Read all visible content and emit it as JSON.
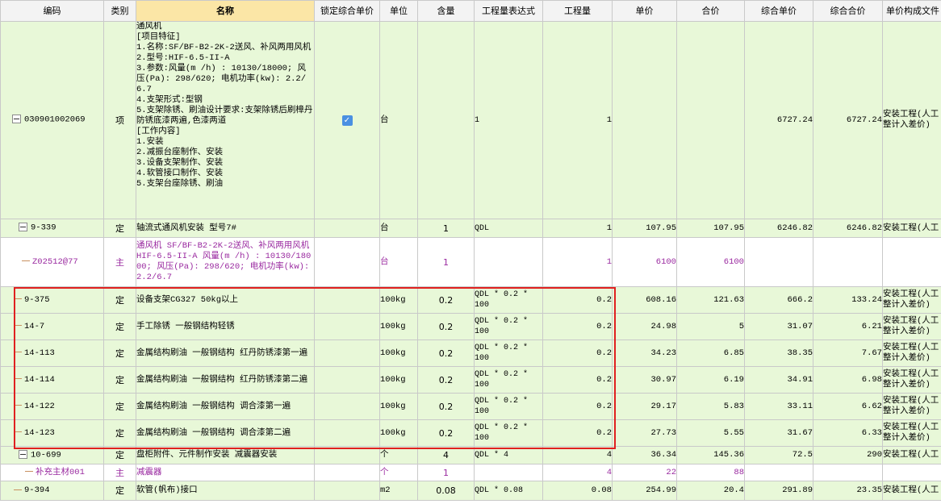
{
  "header": {
    "code": "编码",
    "type": "类别",
    "name": "名称",
    "lock": "锁定综合单价",
    "unit": "单位",
    "content": "含量",
    "expr": "工程量表达式",
    "qty": "工程量",
    "price": "单价",
    "total": "合价",
    "comp_price": "综合单价",
    "comp_total": "综合合价",
    "compose": "单价构成文件"
  },
  "item": {
    "code": "030901002069",
    "type": "项",
    "name_lines": [
      "通风机",
      "[项目特征]",
      "1.名称:SF/BF-B2-2K-2送风、补风两用风机",
      "2.型号:HIF-6.5-II-A",
      "3.参数:风量(m /h) : 10130/18000; 风压(Pa): 298/620; 电机功率(kw): 2.2/6.7",
      "4.支架形式:型钢",
      "5.支架除锈、刷油设计要求:支架除锈后刷樟丹防锈底漆两遍,色漆两道",
      "[工作内容]",
      "1.安装",
      "2.减振台座制作、安装",
      "3.设备支架制作、安装",
      "4.软管接口制作、安装",
      "5.支架台座除锈、刷油"
    ],
    "unit": "台",
    "expr": "1",
    "qty": "1",
    "comp_price": "6727.24",
    "comp_total": "6727.24",
    "compose": "安装工程(人工整计入差价)"
  },
  "rows": [
    {
      "code": "9-339",
      "type": "定",
      "name": "轴流式通风机安装 型号7#",
      "unit": "台",
      "content": "1",
      "expr": "QDL",
      "qty": "1",
      "price": "107.95",
      "total": "107.95",
      "comp_price": "6246.82",
      "comp_total": "6246.82",
      "compose": "安装工程(人工"
    },
    {
      "code": "Z02512@77",
      "type": "主",
      "name": "通风机 SF/BF-B2-2K-2送风、补风两用风机 HIF-6.5-II-A 风量(m /h) : 10130/18000; 风压(Pa): 298/620; 电机功率(kw): 2.2/6.7",
      "unit": "台",
      "content": "1",
      "expr": "",
      "qty": "1",
      "price": "6100",
      "total": "6100",
      "comp_price": "",
      "comp_total": "",
      "compose": ""
    },
    {
      "code": "9-375",
      "type": "定",
      "name": "设备支架CG327 50kg以上",
      "unit": "100kg",
      "content": "0.2",
      "expr": "QDL * 0.2 * 100",
      "qty": "0.2",
      "price": "608.16",
      "total": "121.63",
      "comp_price": "666.2",
      "comp_total": "133.24",
      "compose": "安装工程(人工整计入差价)"
    },
    {
      "code": "14-7",
      "type": "定",
      "name": "手工除锈 一般钢结构轻锈",
      "unit": "100kg",
      "content": "0.2",
      "expr": "QDL * 0.2 * 100",
      "qty": "0.2",
      "price": "24.98",
      "total": "5",
      "comp_price": "31.07",
      "comp_total": "6.21",
      "compose": "安装工程(人工整计入差价)"
    },
    {
      "code": "14-113",
      "type": "定",
      "name": "金属结构刷油 一般钢结构 红丹防锈漆第一遍",
      "unit": "100kg",
      "content": "0.2",
      "expr": "QDL * 0.2 * 100",
      "qty": "0.2",
      "price": "34.23",
      "total": "6.85",
      "comp_price": "38.35",
      "comp_total": "7.67",
      "compose": "安装工程(人工整计入差价)"
    },
    {
      "code": "14-114",
      "type": "定",
      "name": "金属结构刷油 一般钢结构 红丹防锈漆第二遍",
      "unit": "100kg",
      "content": "0.2",
      "expr": "QDL * 0.2 * 100",
      "qty": "0.2",
      "price": "30.97",
      "total": "6.19",
      "comp_price": "34.91",
      "comp_total": "6.98",
      "compose": "安装工程(人工整计入差价)"
    },
    {
      "code": "14-122",
      "type": "定",
      "name": "金属结构刷油 一般钢结构 调合漆第一遍",
      "unit": "100kg",
      "content": "0.2",
      "expr": "QDL * 0.2 * 100",
      "qty": "0.2",
      "price": "29.17",
      "total": "5.83",
      "comp_price": "33.11",
      "comp_total": "6.62",
      "compose": "安装工程(人工整计入差价)"
    },
    {
      "code": "14-123",
      "type": "定",
      "name": "金属结构刷油 一般钢结构 调合漆第二遍",
      "unit": "100kg",
      "content": "0.2",
      "expr": "QDL * 0.2 * 100",
      "qty": "0.2",
      "price": "27.73",
      "total": "5.55",
      "comp_price": "31.67",
      "comp_total": "6.33",
      "compose": "安装工程(人工整计入差价)"
    },
    {
      "code": "10-699",
      "type": "定",
      "name": "盘柜附件、元件制作安装 减震器安装",
      "unit": "个",
      "content": "4",
      "expr": "QDL * 4",
      "qty": "4",
      "price": "36.34",
      "total": "145.36",
      "comp_price": "72.5",
      "comp_total": "290",
      "compose": "安装工程(人工"
    },
    {
      "code": "补充主材001",
      "type": "主",
      "name": "减震器",
      "unit": "个",
      "content": "1",
      "expr": "",
      "qty": "4",
      "price": "22",
      "total": "88",
      "comp_price": "",
      "comp_total": "",
      "compose": ""
    },
    {
      "code": "9-394",
      "type": "定",
      "name": "软管(帆布)接口",
      "unit": "m2",
      "content": "0.08",
      "expr": "QDL * 0.08",
      "qty": "0.08",
      "price": "254.99",
      "total": "20.4",
      "comp_price": "291.89",
      "comp_total": "23.35",
      "compose": "安装工程(人工"
    }
  ],
  "colors": {
    "row_green": "#e8f8d8",
    "main_purple": "#9a2aa0",
    "highlight_box": "#e02020",
    "header_highlight": "#fbe6a6",
    "checkbox": "#4a90e2"
  }
}
